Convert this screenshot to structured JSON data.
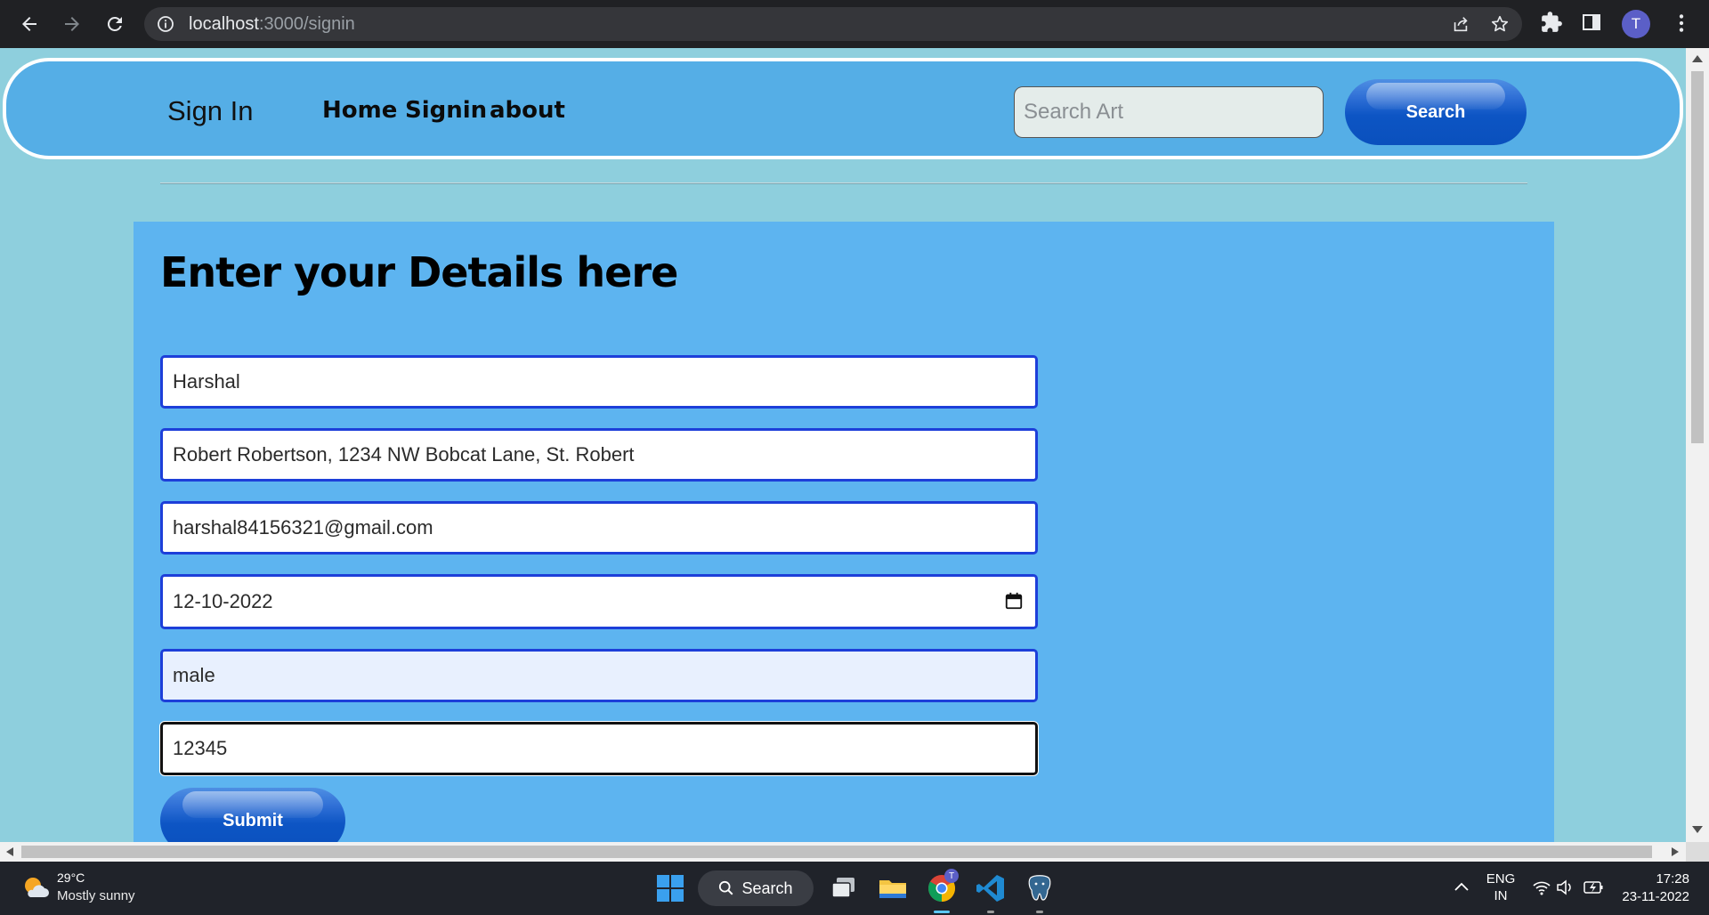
{
  "browser": {
    "url_host": "localhost",
    "url_path": ":3000/signin",
    "profile_initial": "T"
  },
  "navbar": {
    "brand": "Sign In",
    "links": [
      "Home",
      "Signin",
      "about"
    ],
    "search_placeholder": "Search Art",
    "search_button": "Search"
  },
  "form": {
    "heading": "Enter your Details here",
    "fields": [
      {
        "value": "Harshal"
      },
      {
        "value": "Robert Robertson, 1234 NW Bobcat Lane, St. Robert"
      },
      {
        "value": "harshal84156321@gmail.com"
      },
      {
        "value": "12-10-2022"
      },
      {
        "value": "male"
      },
      {
        "value": "12345"
      }
    ],
    "submit_label": "Submit"
  },
  "taskbar": {
    "weather_temp": "29°C",
    "weather_condition": "Mostly sunny",
    "search_label": "Search",
    "teams_badge": "T",
    "lang_line1": "ENG",
    "lang_line2": "IN",
    "time": "17:28",
    "date": "23-11-2022"
  },
  "colors": {
    "page_bg": "#8ecfdd",
    "navbar_bg": "#55aee6",
    "card_bg": "#5db4f0",
    "field_border": "#1d3fd9",
    "button_blue": "#0d55c4"
  }
}
